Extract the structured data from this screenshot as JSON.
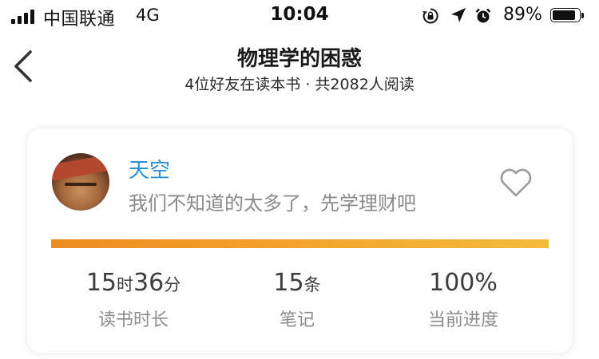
{
  "status_bar": {
    "carrier": "中国联通",
    "network": "4G",
    "time": "10:04",
    "battery_percent": "89%",
    "battery_level": 0.89,
    "icons": [
      "orientation-lock-icon",
      "location-arrow-icon",
      "alarm-icon",
      "battery-icon"
    ]
  },
  "header": {
    "title": "物理学的困惑",
    "subtitle": "4位好友在读本书 · 共2082人阅读",
    "back_icon": "chevron-left-icon"
  },
  "card": {
    "user_name": "天空",
    "comment": "我们不知道的太多了，先学理财吧",
    "like_icon": "heart-outline-icon",
    "progress_fraction": 1.0,
    "progress_colors": [
      "#ef8c20",
      "#f5bb3a"
    ],
    "name_color": "#2a8fd8",
    "stats": {
      "reading_time": {
        "hours": "15",
        "hours_unit": "时",
        "minutes": "36",
        "minutes_unit": "分",
        "label": "读书时长"
      },
      "notes": {
        "count": "15",
        "unit": "条",
        "label": "笔记"
      },
      "progress": {
        "value": "100%",
        "label": "当前进度"
      }
    }
  }
}
